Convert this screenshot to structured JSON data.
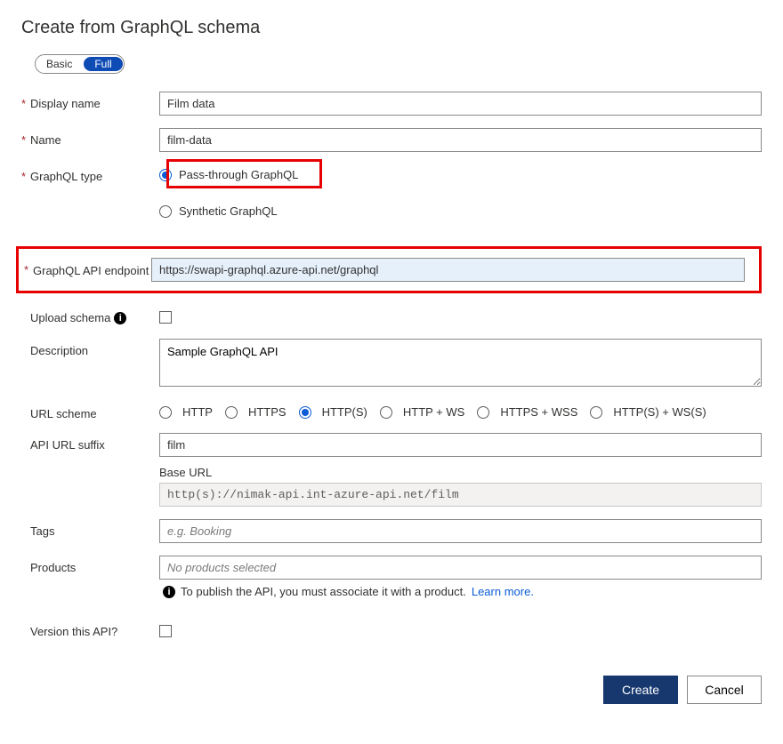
{
  "title": "Create from GraphQL schema",
  "toggle": {
    "basic": "Basic",
    "full": "Full"
  },
  "fields": {
    "displayName": {
      "label": "Display name",
      "value": "Film data"
    },
    "name": {
      "label": "Name",
      "value": "film-data"
    },
    "graphqlType": {
      "label": "GraphQL type",
      "options": {
        "passthrough": "Pass-through GraphQL",
        "synthetic": "Synthetic GraphQL"
      }
    },
    "endpoint": {
      "label": "GraphQL API endpoint",
      "value": "https://swapi-graphql.azure-api.net/graphql"
    },
    "uploadSchema": {
      "label": "Upload schema"
    },
    "description": {
      "label": "Description",
      "value": "Sample GraphQL API"
    },
    "urlScheme": {
      "label": "URL scheme",
      "options": [
        "HTTP",
        "HTTPS",
        "HTTP(S)",
        "HTTP + WS",
        "HTTPS + WSS",
        "HTTP(S) + WS(S)"
      ],
      "selectedIndex": 2
    },
    "apiUrlSuffix": {
      "label": "API URL suffix",
      "value": "film"
    },
    "baseUrl": {
      "label": "Base URL",
      "value": "http(s)://nimak-api.int-azure-api.net/film"
    },
    "tags": {
      "label": "Tags",
      "placeholder": "e.g. Booking"
    },
    "products": {
      "label": "Products",
      "placeholder": "No products selected"
    },
    "publishInfo": {
      "text": "To publish the API, you must associate it with a product.",
      "link": "Learn more"
    },
    "versionApi": {
      "label": "Version this API?"
    }
  },
  "buttons": {
    "create": "Create",
    "cancel": "Cancel"
  }
}
